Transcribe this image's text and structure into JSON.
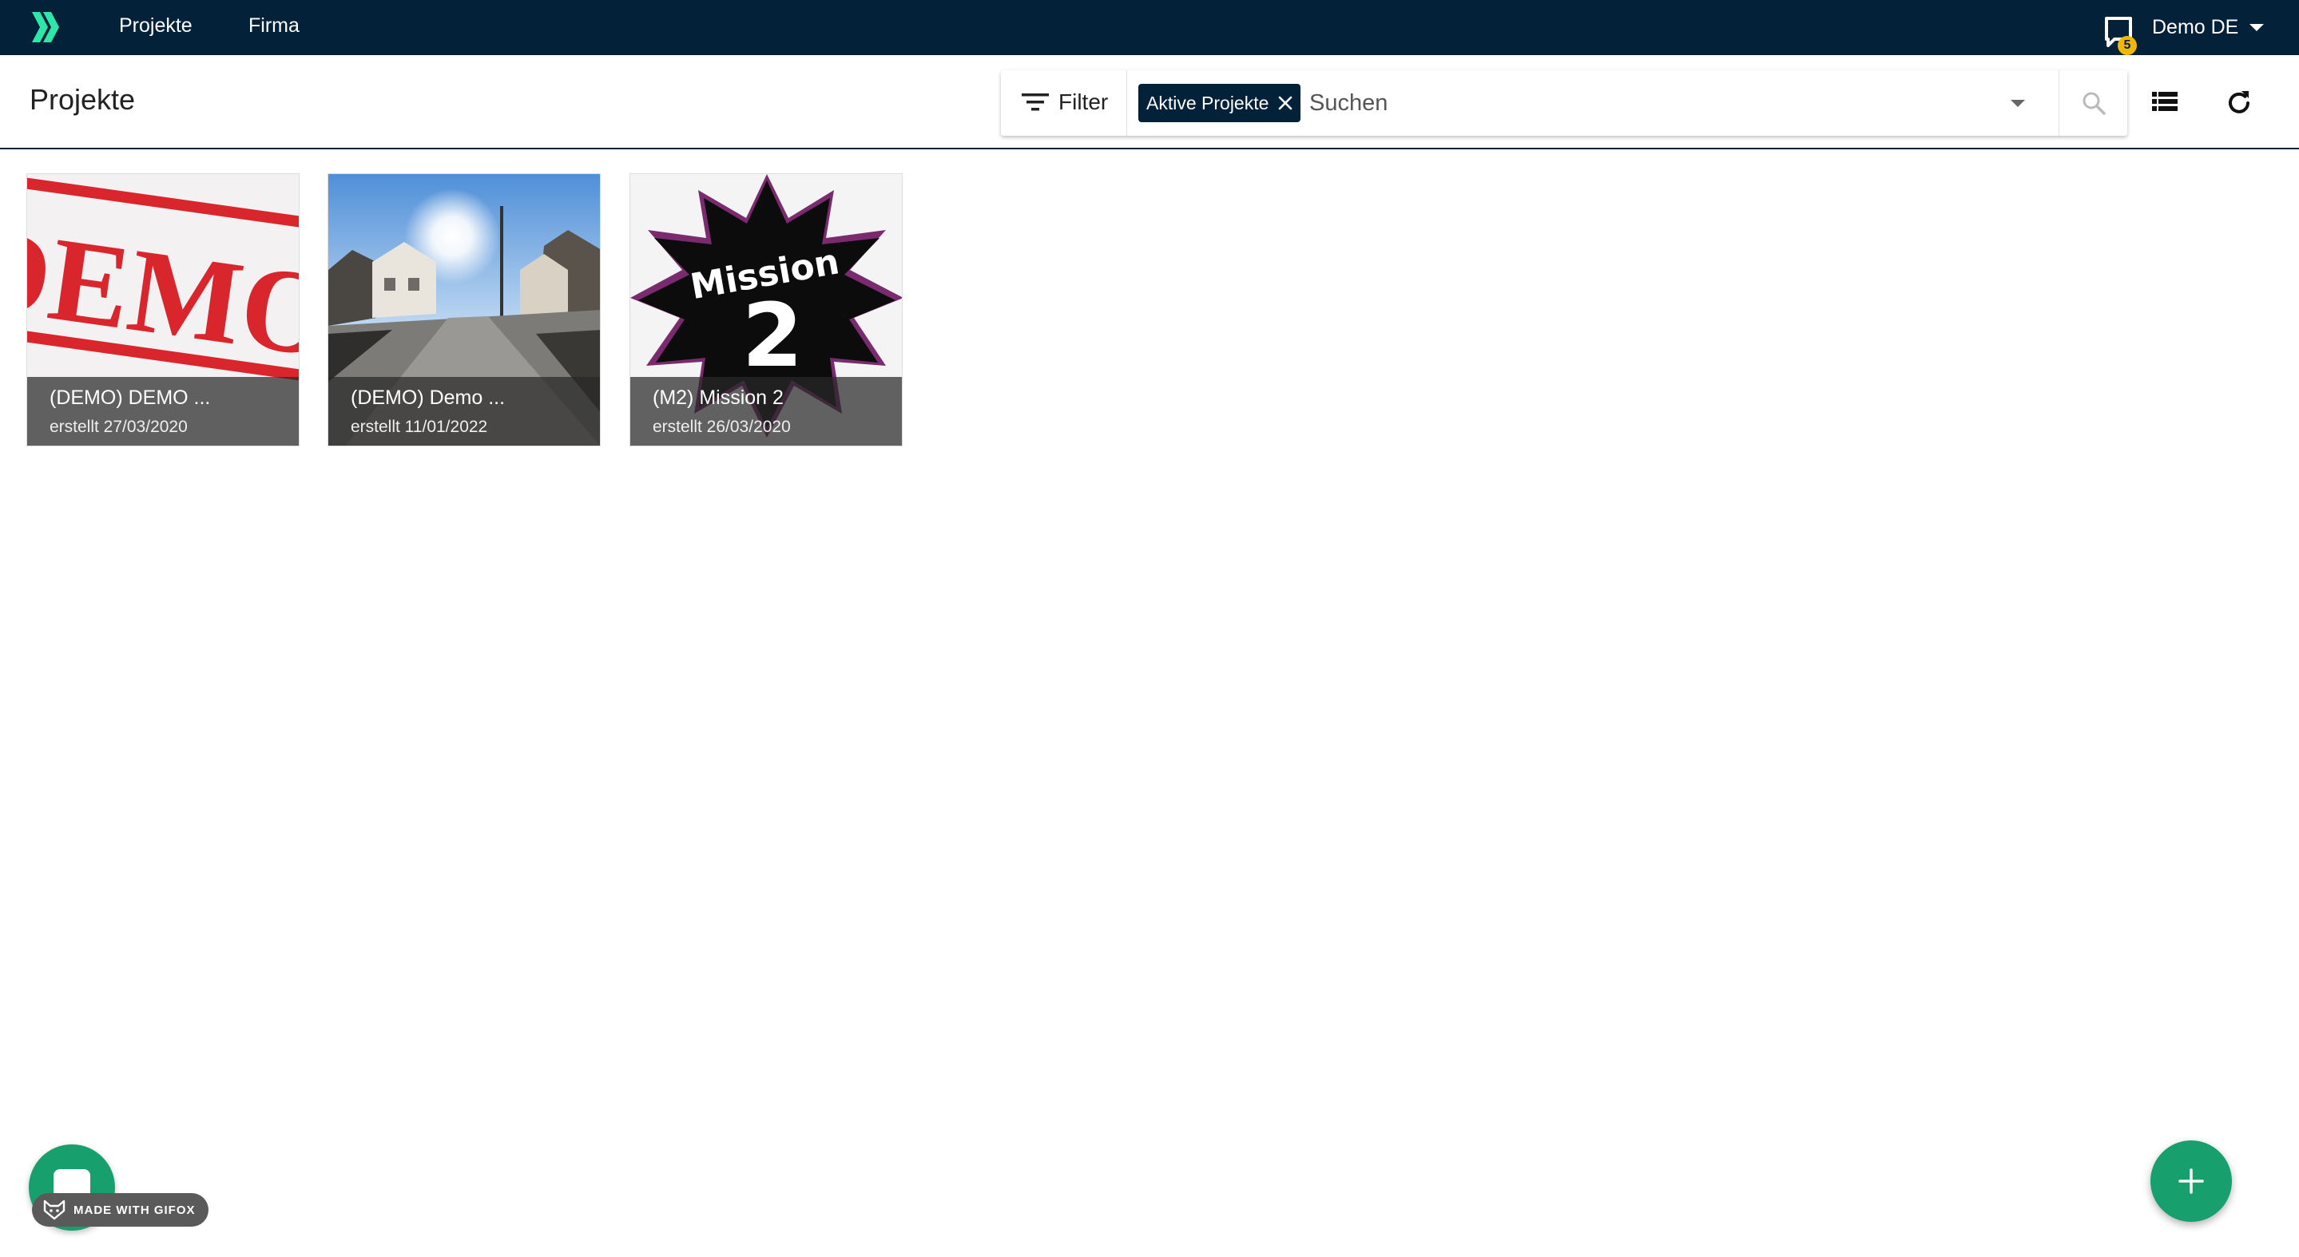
{
  "nav": {
    "items": [
      {
        "label": "Projekte"
      },
      {
        "label": "Firma"
      }
    ],
    "notification_count": "5",
    "user_name": "Demo DE"
  },
  "header": {
    "title": "Projekte",
    "filter_label": "Filter",
    "active_chip": "Aktive Projekte",
    "search_placeholder": "Suchen"
  },
  "projects": [
    {
      "title": "(DEMO) DEMO ...",
      "created": "erstellt 27/03/2020",
      "image_text": "DEMO"
    },
    {
      "title": "(DEMO) Demo ...",
      "created": "erstellt 11/01/2022"
    },
    {
      "title": "(M2) Mission 2",
      "created": "erstellt 26/03/2020",
      "image_text": "Mission",
      "image_number": "2"
    }
  ],
  "watermark": {
    "text": "MADE WITH GIFOX"
  },
  "colors": {
    "topbar": "#04213a",
    "accent": "#17a06e",
    "logo": "#2ee6a8",
    "badge": "#f2b705"
  },
  "icons": {
    "logo": "double-chevron-logo",
    "notifications": "chat-bubble-icon",
    "filter": "filter-lines-icon",
    "search": "search-icon",
    "list_view": "list-view-icon",
    "refresh": "refresh-icon",
    "add": "plus-icon",
    "chat": "chat-icon"
  }
}
